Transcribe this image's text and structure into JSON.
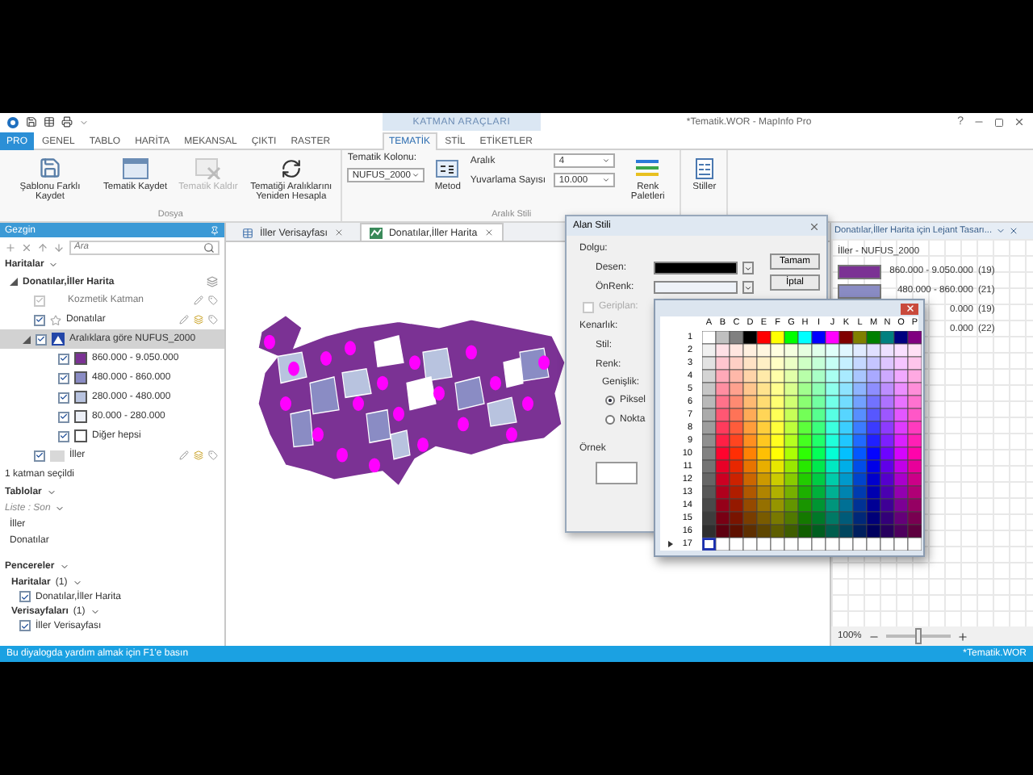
{
  "window": {
    "title": "*Tematik.WOR - MapInfo Pro",
    "help": "?"
  },
  "ribbon": {
    "tabs": [
      {
        "label": "PRO",
        "kind": "file",
        "selected": false
      },
      {
        "label": "GENEL",
        "kind": "tab",
        "selected": false
      },
      {
        "label": "TABLO",
        "kind": "tab",
        "selected": false
      },
      {
        "label": "HARİTA",
        "kind": "tab",
        "selected": false
      },
      {
        "label": "MEKANSAL",
        "kind": "tab",
        "selected": false
      },
      {
        "label": "ÇIKTI",
        "kind": "tab",
        "selected": false
      },
      {
        "label": "RASTER",
        "kind": "tab",
        "selected": false
      }
    ],
    "context_group": {
      "header": "KATMAN ARAÇLARI",
      "tabs": [
        {
          "label": "TEMATİK",
          "selected": true
        },
        {
          "label": "STİL",
          "selected": false
        },
        {
          "label": "ETİKETLER",
          "selected": false
        }
      ]
    },
    "file_group": {
      "label": "Dosya",
      "buttons": [
        {
          "label": "Şablonu Farklı Kaydet",
          "kind": "save-template",
          "disabled": false
        },
        {
          "label": "Tematik Kaydet",
          "kind": "save",
          "disabled": false
        },
        {
          "label": "Tematik Kaldır",
          "kind": "remove",
          "disabled": true
        },
        {
          "label": "Tematiği Aralıklarını Yeniden Hesapla",
          "kind": "recalc",
          "disabled": false
        }
      ]
    },
    "range_group": {
      "label": "Aralık Stili",
      "column_label": "Tematik Kolonu:",
      "column_value": "NUFUS_2000",
      "method": "Metod",
      "range_label": "Aralık",
      "range_value": "4",
      "rounding_label": "Yuvarlama Sayısı",
      "rounding_value": "10.000",
      "palettes": "Renk Paletleri"
    },
    "styles_group": {
      "button": "Stiller"
    }
  },
  "navigator": {
    "title": "Gezgin",
    "search": {
      "placeholder": "Ara"
    },
    "maps_heading": "Haritalar",
    "map": {
      "label": "Donatılar,İller Harita",
      "expanded": true,
      "layers": [
        {
          "label": "Kozmetik Katman",
          "kind": "cosmetic",
          "checked": true,
          "disabled": true,
          "selected": false
        },
        {
          "label": "Donatılar",
          "kind": "points",
          "checked": true,
          "disabled": false,
          "selected": false
        },
        {
          "label": "Aralıklara göre NUFUS_2000",
          "kind": "thematic",
          "checked": true,
          "disabled": false,
          "selected": true,
          "expanded": true,
          "children": [
            {
              "label": "860.000 - 9.050.000",
              "color": "#7b3294",
              "checked": true
            },
            {
              "label": "480.000 - 860.000",
              "color": "#8a8cc4",
              "checked": true
            },
            {
              "label": "280.000 - 480.000",
              "color": "#b8c3df",
              "checked": true
            },
            {
              "label": "80.000 - 280.000",
              "color": "#eceff6",
              "checked": true
            },
            {
              "label": "Diğer hepsi",
              "color": "#ffffff",
              "checked": true
            }
          ]
        },
        {
          "label": "İller",
          "kind": "regions",
          "checked": true,
          "disabled": false,
          "selected": false
        }
      ]
    },
    "selection_note": "1 katman seçildi",
    "tables_heading": "Tablolar",
    "tables_sort": "Liste : Son",
    "tables": [
      "İller",
      "Donatılar"
    ],
    "windows_heading": "Pencereler",
    "window_groups": [
      {
        "label": "Haritalar",
        "count": "(1)",
        "items": [
          {
            "label": "Donatılar,İller Harita",
            "checked": true
          }
        ]
      },
      {
        "label": "Verisayfaları",
        "count": "(1)",
        "items": [
          {
            "label": "İller Verisayfası",
            "checked": true
          }
        ]
      }
    ]
  },
  "document_tabs": [
    {
      "label": "İller Verisayfası",
      "kind": "browser",
      "selected": false
    },
    {
      "label": "Donatılar,İller Harita",
      "kind": "map",
      "selected": true
    }
  ],
  "legend": {
    "title": "Donatılar,İller Harita için Lejant Tasarı...",
    "subtitle": "İller - NUFUS_2000",
    "rows": [
      {
        "range": "860.000 - 9.050.000",
        "count": "(19)",
        "color": "#7b3294"
      },
      {
        "range": "480.000 - 860.000",
        "count": "(21)",
        "color": "#8a8cc4"
      },
      {
        "range": "0.000",
        "count": "(19)"
      },
      {
        "range": "0.000",
        "count": "(22)"
      }
    ],
    "zoom": "100%",
    "zoom_slider": {
      "level": 0.5
    }
  },
  "area_style_dialog": {
    "title": "Alan Stili",
    "fill_heading": "Dolgu:",
    "pattern_label": "Desen:",
    "foreground_label": "ÖnRenk:",
    "background": {
      "label": "Geriplan:",
      "checked": false,
      "disabled": true
    },
    "border_heading": "Kenarlık:",
    "style_label": "Stil:",
    "color_label": "Renk:",
    "width_label": "Genişlik:",
    "units": [
      {
        "label": "Piksel",
        "selected": true
      },
      {
        "label": "Nokta",
        "selected": false
      }
    ],
    "preview_label": "Örnek",
    "buttons": [
      "Tamam",
      "İptal"
    ]
  },
  "palette": {
    "columns": [
      "A",
      "B",
      "C",
      "D",
      "E",
      "F",
      "G",
      "H",
      "I",
      "J",
      "K",
      "L",
      "M",
      "N",
      "O",
      "P"
    ],
    "rows": [
      {
        "label": "1",
        "current": false
      },
      {
        "label": "2",
        "current": false
      },
      {
        "label": "3",
        "current": false
      },
      {
        "label": "4",
        "current": false
      },
      {
        "label": "5",
        "current": false
      },
      {
        "label": "6",
        "current": false
      },
      {
        "label": "7",
        "current": false
      },
      {
        "label": "8",
        "current": false
      },
      {
        "label": "9",
        "current": false
      },
      {
        "label": "10",
        "current": false
      },
      {
        "label": "11",
        "current": false
      },
      {
        "label": "12",
        "current": false
      },
      {
        "label": "13",
        "current": false
      },
      {
        "label": "14",
        "current": false
      },
      {
        "label": "15",
        "current": false
      },
      {
        "label": "16",
        "current": false
      },
      {
        "label": "17",
        "current": true
      }
    ]
  },
  "status_bar": {
    "message": "Bu diyalogda yardım almak için F1'e basın",
    "workspace": "*Tematik.WOR"
  }
}
